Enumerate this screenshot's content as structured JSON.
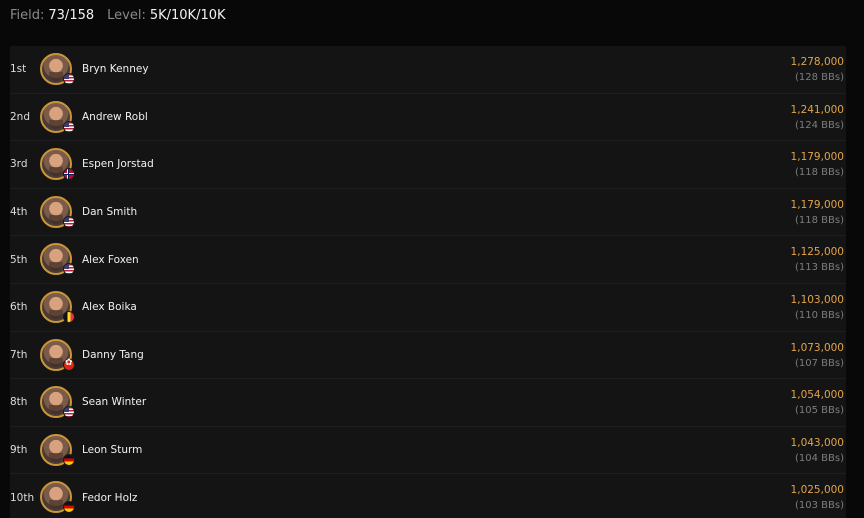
{
  "header": {
    "field_label": "Field:",
    "field_value": "73/158",
    "level_label": "Level:",
    "level_value": "5K/10K/10K"
  },
  "colors": {
    "background": "#080808",
    "row_background": "#141414",
    "chip_accent": "#e0a448",
    "avatar_ring": "#c9963a"
  },
  "players": [
    {
      "rank": "1st",
      "name": "Bryn Kenney",
      "chips": "1,278,000",
      "bbs": "(128 BBs)",
      "flag": "us",
      "icon": "us-flag-icon"
    },
    {
      "rank": "2nd",
      "name": "Andrew Robl",
      "chips": "1,241,000",
      "bbs": "(124 BBs)",
      "flag": "us",
      "icon": "us-flag-icon"
    },
    {
      "rank": "3rd",
      "name": "Espen Jorstad",
      "chips": "1,179,000",
      "bbs": "(118 BBs)",
      "flag": "no",
      "icon": "norway-flag-icon"
    },
    {
      "rank": "4th",
      "name": "Dan Smith",
      "chips": "1,179,000",
      "bbs": "(118 BBs)",
      "flag": "us",
      "icon": "us-flag-icon"
    },
    {
      "rank": "5th",
      "name": "Alex Foxen",
      "chips": "1,125,000",
      "bbs": "(113 BBs)",
      "flag": "us",
      "icon": "us-flag-icon"
    },
    {
      "rank": "6th",
      "name": "Alex Boika",
      "chips": "1,103,000",
      "bbs": "(110 BBs)",
      "flag": "be",
      "icon": "belarus-flag-icon"
    },
    {
      "rank": "7th",
      "name": "Danny Tang",
      "chips": "1,073,000",
      "bbs": "(107 BBs)",
      "flag": "hk",
      "icon": "hong-kong-flag-icon"
    },
    {
      "rank": "8th",
      "name": "Sean Winter",
      "chips": "1,054,000",
      "bbs": "(105 BBs)",
      "flag": "us",
      "icon": "us-flag-icon"
    },
    {
      "rank": "9th",
      "name": "Leon Sturm",
      "chips": "1,043,000",
      "bbs": "(104 BBs)",
      "flag": "de",
      "icon": "germany-flag-icon"
    },
    {
      "rank": "10th",
      "name": "Fedor Holz",
      "chips": "1,025,000",
      "bbs": "(103 BBs)",
      "flag": "de",
      "icon": "germany-flag-icon"
    }
  ]
}
